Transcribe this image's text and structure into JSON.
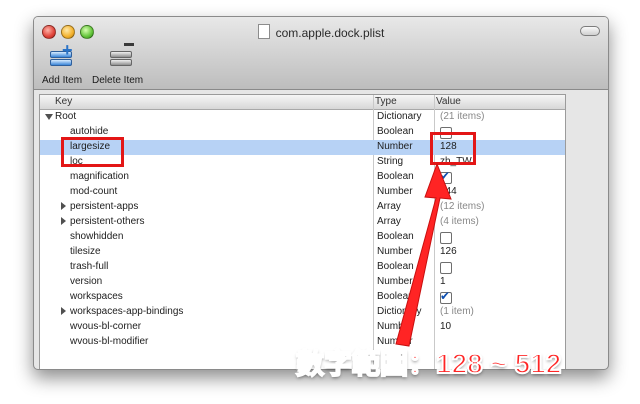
{
  "window": {
    "title": "com.apple.dock.plist"
  },
  "toolbar": {
    "add_label": "Add Item",
    "delete_label": "Delete Item"
  },
  "table": {
    "columns": {
      "key": "Key",
      "type": "Type",
      "value": "Value"
    },
    "rows": [
      {
        "key": "Root",
        "type": "Dictionary",
        "value": "(21 items)"
      },
      {
        "key": "autohide",
        "type": "Boolean",
        "value": ""
      },
      {
        "key": "largesize",
        "type": "Number",
        "value": "128"
      },
      {
        "key": "loc",
        "type": "String",
        "value": "zh_TW"
      },
      {
        "key": "magnification",
        "type": "Boolean",
        "value": ""
      },
      {
        "key": "mod-count",
        "type": "Number",
        "value": "344"
      },
      {
        "key": "persistent-apps",
        "type": "Array",
        "value": "(12 items)"
      },
      {
        "key": "persistent-others",
        "type": "Array",
        "value": "(4 items)"
      },
      {
        "key": "showhidden",
        "type": "Boolean",
        "value": ""
      },
      {
        "key": "tilesize",
        "type": "Number",
        "value": "126"
      },
      {
        "key": "trash-full",
        "type": "Boolean",
        "value": ""
      },
      {
        "key": "version",
        "type": "Number",
        "value": "1"
      },
      {
        "key": "workspaces",
        "type": "Boolean",
        "value": ""
      },
      {
        "key": "workspaces-app-bindings",
        "type": "Dictionary",
        "value": "(1 item)"
      },
      {
        "key": "wvous-bl-corner",
        "type": "Number",
        "value": "10"
      },
      {
        "key": "wvous-bl-modifier",
        "type": "Number",
        "value": ""
      }
    ]
  },
  "annotation": {
    "text": "數字範圍：128 ~ 512"
  },
  "colors": {
    "highlight": "#e31616",
    "selection": "#b7d2f5",
    "scroll": "#3f87e8"
  }
}
